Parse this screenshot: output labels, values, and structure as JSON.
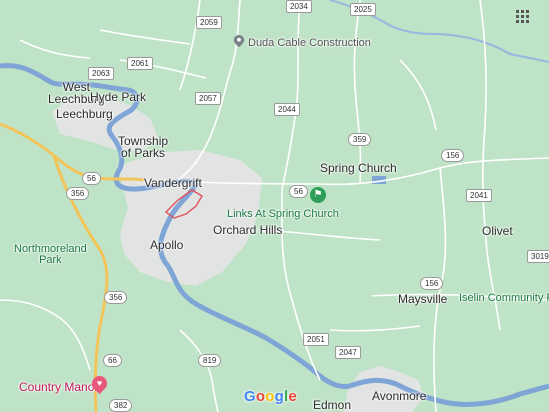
{
  "map": {
    "labels": {
      "west_leechburg": "West\nLeechburg",
      "hyde_park": "Hyde Park",
      "leechburg": "Leechburg",
      "township_of_parks": "Township\nof Parks",
      "vandergrift": "Vandergrift",
      "apollo": "Apollo",
      "orchard_hills": "Orchard Hills",
      "spring_church": "Spring Church",
      "links_at_spring_church": "Links At Spring Church",
      "duda_cable": "Duda Cable Construction",
      "northmoreland_park": "Northmoreland\nPark",
      "olivet": "Olivet",
      "maysville": "Maysville",
      "iselin_park": "Iselin Community Park",
      "country_manor": "Country Manor",
      "edmon": "Edmon",
      "avonmore": "Avonmore"
    },
    "shields": {
      "r2059": "2059",
      "r2034": "2034",
      "r2025": "2025",
      "r2063": "2063",
      "r2061": "2061",
      "r2057": "2057",
      "r2044": "2044",
      "r359": "359",
      "r156a": "156",
      "r56a": "56",
      "r56b": "56",
      "r356a": "356",
      "r2041": "2041",
      "r3019": "3019",
      "r156b": "156",
      "r356b": "356",
      "r819": "819",
      "r2051": "2051",
      "r2047": "2047",
      "r66": "66",
      "r382": "382"
    },
    "google_logo": {
      "letters": [
        "G",
        "o",
        "o",
        "g",
        "l",
        "e"
      ],
      "colors": [
        "#4285F4",
        "#EA4335",
        "#FBBC05",
        "#4285F4",
        "#34A853",
        "#EA4335"
      ]
    },
    "colors": {
      "land": "#bfe3c6",
      "urban": "#e2e4e3",
      "water": "#7fa5d6",
      "highway": "#f2c45a",
      "road": "#ffffff",
      "boundary": "#e0525b"
    },
    "icons": {
      "grid": "apps-grid-icon",
      "duda_pin": "location-pin-icon",
      "golf": "golf-icon",
      "restaurant": "restaurant-icon"
    }
  }
}
